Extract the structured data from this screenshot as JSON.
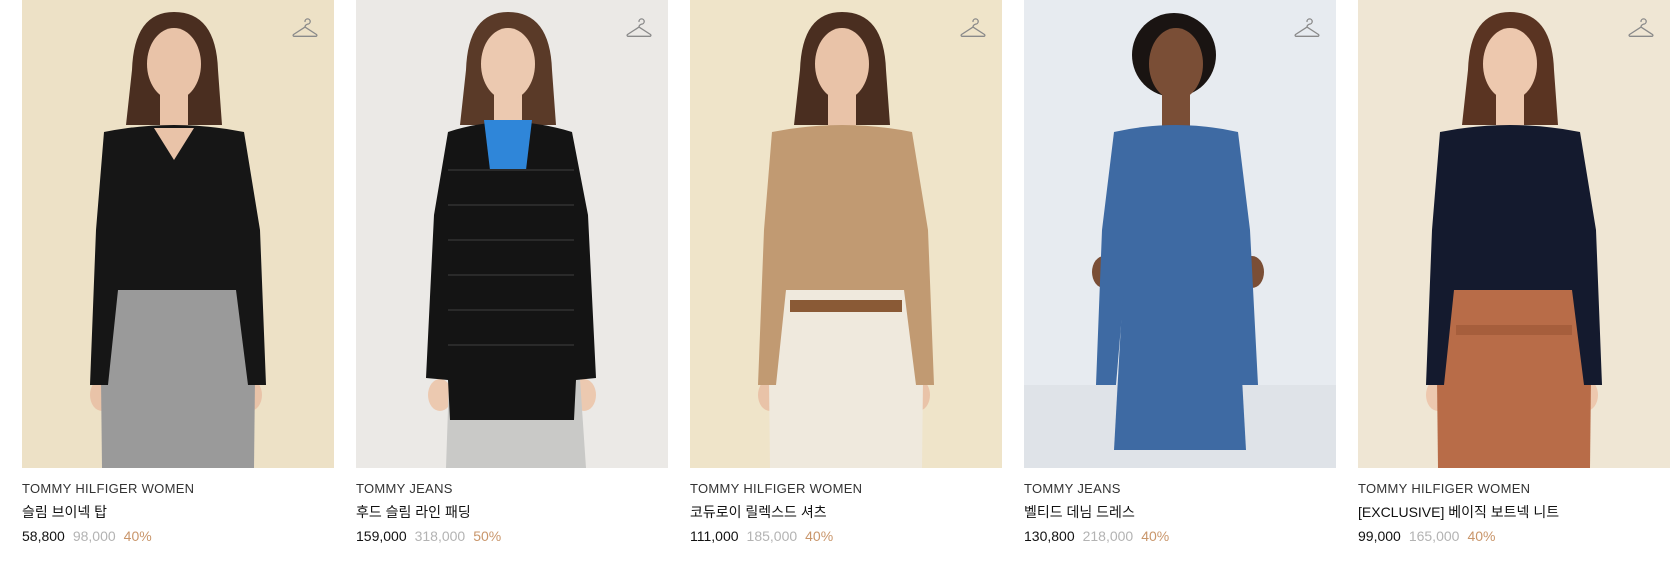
{
  "products": [
    {
      "brand": "TOMMY HILFIGER WOMEN",
      "name": "슬림 브이넥 탑",
      "sale_price": "58,800",
      "original_price": "98,000",
      "discount": "40%",
      "bg_color": "#ede1c6",
      "top_color": "#161616",
      "bottom_color": "#9a9a9a",
      "hair_color": "#4a2e20",
      "skin_color": "#e9c3a8"
    },
    {
      "brand": "TOMMY JEANS",
      "name": "후드 슬림 라인 패딩",
      "sale_price": "159,000",
      "original_price": "318,000",
      "discount": "50%",
      "bg_color": "#ebe9e6",
      "top_color": "#141414",
      "bottom_color": "#c9c9c7",
      "hair_color": "#5a3a28",
      "skin_color": "#ecc9b0"
    },
    {
      "brand": "TOMMY HILFIGER WOMEN",
      "name": "코듀로이 릴렉스드 셔츠",
      "sale_price": "111,000",
      "original_price": "185,000",
      "discount": "40%",
      "bg_color": "#efe4c9",
      "top_color": "#c19a72",
      "bottom_color": "#efe9dd",
      "hair_color": "#4a2e20",
      "skin_color": "#e9c3a8"
    },
    {
      "brand": "TOMMY JEANS",
      "name": "벨티드 데님 드레스",
      "sale_price": "130,800",
      "original_price": "218,000",
      "discount": "40%",
      "bg_color": "#e7ebf0",
      "top_color": "#3e6aa3",
      "bottom_color": "#3e6aa3",
      "hair_color": "#1a1412",
      "skin_color": "#7a4e36"
    },
    {
      "brand": "TOMMY HILFIGER WOMEN",
      "name": "[EXCLUSIVE] 베이직 보트넥 니트",
      "sale_price": "99,000",
      "original_price": "165,000",
      "discount": "40%",
      "bg_color": "#efe6d4",
      "top_color": "#141a2e",
      "bottom_color": "#b86c48",
      "hair_color": "#5a3422",
      "skin_color": "#edc8ae"
    }
  ]
}
